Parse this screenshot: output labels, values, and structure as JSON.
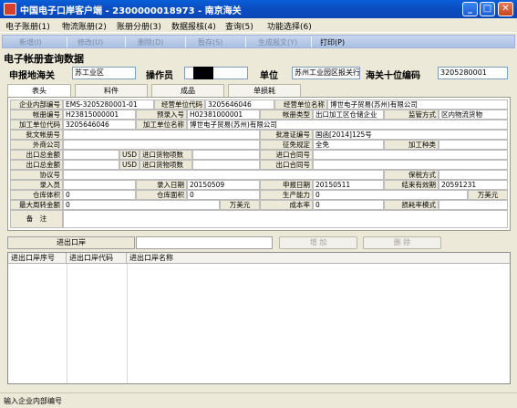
{
  "window": {
    "title": "中国电子口岸客户端 - 2300000018973 - 南京海关",
    "min": "_",
    "max": "□",
    "close": "✕"
  },
  "menu": [
    "电子账册(1)",
    "物流账册(2)",
    "账册分册(3)",
    "数据报核(4)",
    "查询(5)",
    "功能选择(6)"
  ],
  "toolbar": [
    {
      "label": "新增(I)",
      "enabled": false
    },
    {
      "label": "修改(U)",
      "enabled": false
    },
    {
      "label": "删除(D)",
      "enabled": false
    },
    {
      "label": "暂存(S)",
      "enabled": false
    },
    {
      "label": "生成报文(Y)",
      "enabled": false
    },
    {
      "label": "打印(P)",
      "enabled": true
    }
  ],
  "page_heading": "电子帐册查询数据",
  "header": {
    "declare_place_label": "申报地海关",
    "declare_place_value": "苏工业区",
    "operator_label": "操作员",
    "unit_label": "单位",
    "unit_value": "苏州工业园区报关行",
    "customs_code_label": "海关十位编码",
    "customs_code_value": "3205280001"
  },
  "tabs": [
    "表头",
    "料件",
    "成品",
    "单损耗"
  ],
  "form": {
    "enterprise_internal_no_label": "企业内部编号",
    "enterprise_internal_no": "EMS-3205280001-01",
    "business_unit_code_label": "经营单位代码",
    "business_unit_code": "3205646046",
    "business_unit_name_label": "经营单位名称",
    "business_unit_name": "博世电子贸易(苏州)有限公司",
    "book_no_label": "帐册编号",
    "book_no": "H23815000001",
    "pre_entry_no_label": "预录入号",
    "pre_entry_no": "H02381000001",
    "book_type_label": "帐册类型",
    "book_type": "出口加工区仓储企业",
    "supervision_label": "监管方式",
    "supervision": "区内物流货物",
    "processing_unit_code_label": "加工单位代码",
    "processing_unit_code": "3205646046",
    "processing_unit_name_label": "加工单位名称",
    "processing_unit_name": "博世电子贸易(苏州)有限公司",
    "approval_book_no_label": "批文帐册号",
    "approval_cert_no_label": "批准证编号",
    "approval_cert_no": "国函[2014]125号",
    "foreign_company_label": "外商公司",
    "tax_rule_label": "征免规定",
    "tax_rule": "全免",
    "processing_type_label": "加工种类",
    "export_total_label_1": "出口总金额",
    "currency_1": "USD",
    "import_items_label_1": "进口货物项数",
    "import_contract_label": "进口合同号",
    "export_total_label_2": "出口总金额",
    "currency_2": "USD",
    "import_items_label_2": "进口货物项数",
    "export_contract_label": "出口合同号",
    "agreement_no_label": "协议号",
    "guarantee_label": "保税方式",
    "entry_person_label": "录入员",
    "entry_date_label": "录入日期",
    "entry_date": "20150509",
    "declare_date_label": "申报日期",
    "declare_date": "20150511",
    "end_date_label": "结束有效期",
    "end_date": "20591231",
    "warehouse_volume_label": "仓库体积",
    "warehouse_volume": "0",
    "warehouse_area_label": "仓库面积",
    "warehouse_area": "0",
    "capacity_label": "生产能力",
    "capacity": "0",
    "capacity_unit": "万美元",
    "max_turnover_label": "最大周转金额",
    "max_turnover": "0",
    "max_turnover_unit": "万美元",
    "finished_rate_label": "成本率",
    "finished_rate": "0",
    "loss_mode_label": "损耗率模式",
    "remarks_label": "备　注"
  },
  "ports": {
    "label": "进出口岸",
    "add_button": "增 加",
    "delete_button": "删 除",
    "columns": [
      "进出口岸序号",
      "进出口岸代码",
      "进出口岸名称"
    ]
  },
  "status": "输入企业内部编号"
}
